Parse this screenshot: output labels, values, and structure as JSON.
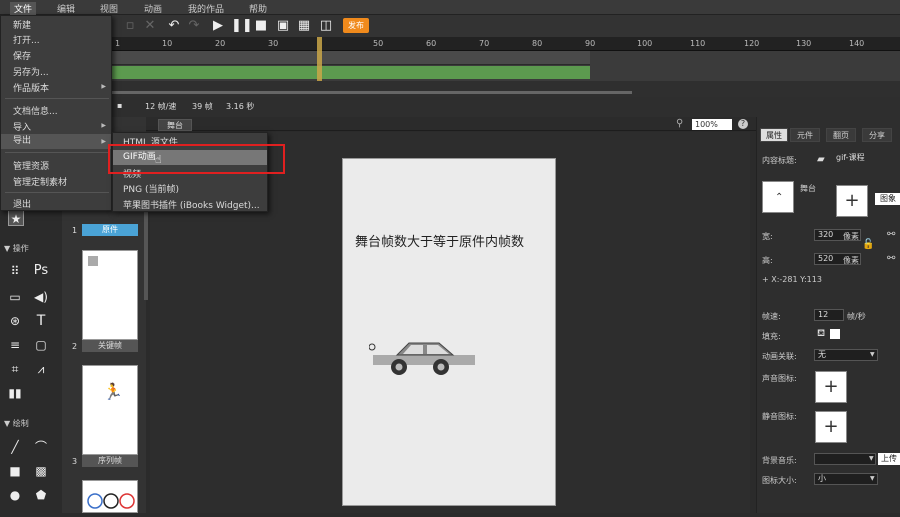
{
  "menubar": {
    "items": [
      "文件",
      "编辑",
      "视图",
      "动画",
      "我的作品",
      "帮助"
    ]
  },
  "toolbar": {
    "publish_label": "发布"
  },
  "timeline": {
    "ruler_ticks": [
      "1",
      "10",
      "20",
      "30",
      "40",
      "50",
      "60",
      "70",
      "80",
      "90",
      "100",
      "110",
      "120",
      "130",
      "140"
    ],
    "current_frame": 40,
    "fps": "12 帧/速",
    "frames": "39 帧",
    "duration": "3.16 秒"
  },
  "stage_tabs": {
    "tab": "舞台",
    "zoom": "100%"
  },
  "stage": {
    "text": "舞台帧数大于等于原件内帧数"
  },
  "file_menu": {
    "items": [
      "新建",
      "打开...",
      "保存",
      "另存为...",
      "作品版本",
      "文档信息...",
      "导入",
      "导出",
      "管理资源",
      "管理定制素材",
      "退出"
    ]
  },
  "export_submenu": {
    "items": [
      "HTML 源文件",
      "GIF动画",
      "视频",
      "PNG (当前帧)",
      "苹果图书插件 (iBooks Widget)..."
    ],
    "highlighted": "GIF动画"
  },
  "left_tools": {
    "section_operate": "操作",
    "section_draw": "绘制",
    "ps_label": "Ps"
  },
  "frames_panel": {
    "frames": [
      {
        "num": "1",
        "label": "原件"
      },
      {
        "num": "2",
        "label": "关键帧"
      },
      {
        "num": "3",
        "label": "序列帧"
      }
    ]
  },
  "right_panel": {
    "tabs": [
      "属性",
      "元件",
      "翻页",
      "分享"
    ],
    "content_title_label": "内容标题:",
    "content_title_value": "gif-课程",
    "stage_label": "舞台",
    "image_button": "图象",
    "width_label": "宽:",
    "width_value": "320",
    "height_label": "高:",
    "height_value": "520",
    "unit": "像素",
    "coords": "+  X:-281   Y:113",
    "framerate_label": "帧速:",
    "framerate_value": "12",
    "framerate_unit": "帧/秒",
    "fill_label": "填充:",
    "anim_link_label": "动画关联:",
    "anim_link_value": "无",
    "sound_icon_label": "声音图标:",
    "mute_icon_label": "静音图标:",
    "bg_music_label": "背景音乐:",
    "upload_label": "上传",
    "icon_size_label": "图标大小:",
    "icon_size_value": "小"
  }
}
